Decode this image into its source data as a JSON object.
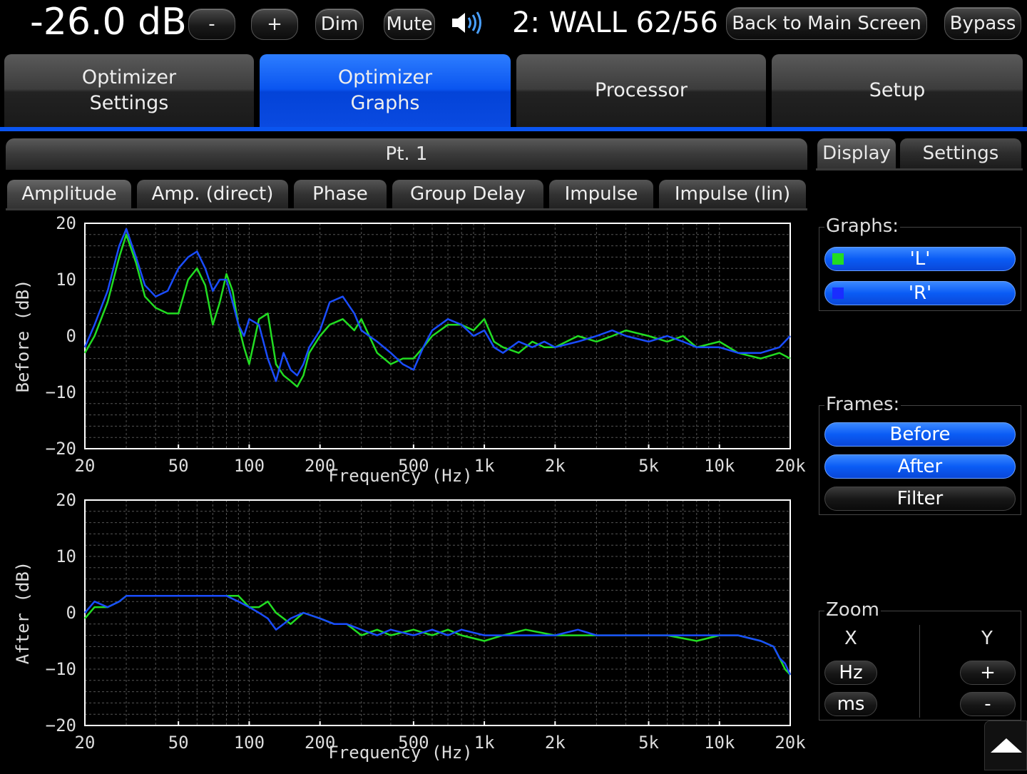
{
  "topbar": {
    "volume": "-26.0 dB",
    "minus_label": "-",
    "plus_label": "+",
    "dim_label": "Dim",
    "mute_label": "Mute",
    "preset": "2: WALL 62/56",
    "back_label": "Back to Main Screen",
    "bypass_label": "Bypass"
  },
  "tabs": [
    {
      "line1": "Optimizer",
      "line2": "Settings"
    },
    {
      "line1": "Optimizer",
      "line2": "Graphs"
    },
    {
      "line1": "Processor",
      "line2": ""
    },
    {
      "line1": "Setup",
      "line2": ""
    }
  ],
  "point_title": "Pt. 1",
  "subtabs": [
    "Amplitude",
    "Amp. (direct)",
    "Phase",
    "Group Delay",
    "Impulse",
    "Impulse (lin)"
  ],
  "side": {
    "display_tab": "Display",
    "settings_tab": "Settings",
    "graphs_label": "Graphs:",
    "graph_L": "'L'",
    "graph_R": "'R'",
    "frames_label": "Frames:",
    "before": "Before",
    "after": "After",
    "filter": "Filter",
    "zoom_label": "Zoom",
    "x_label": "X",
    "y_label": "Y",
    "hz": "Hz",
    "ms": "ms",
    "yplus": "+",
    "yminus": "-"
  },
  "colors": {
    "L": "#22dd22",
    "R": "#1a4dff",
    "accent": "#0a55f0"
  },
  "chart_data": [
    {
      "type": "line",
      "ylabel": "Before (dB)",
      "xlabel": "Frequency (Hz)",
      "x_scale": "log",
      "xlim": [
        20,
        20000
      ],
      "ylim": [
        -20,
        20
      ],
      "x_ticks": [
        20,
        50,
        100,
        200,
        500,
        1000,
        2000,
        5000,
        10000,
        20000
      ],
      "x_tick_labels": [
        "20",
        "50",
        "100",
        "200",
        "500",
        "1k",
        "2k",
        "5k",
        "10k",
        "20k"
      ],
      "y_ticks": [
        -20,
        -10,
        0,
        10,
        20
      ],
      "y_tick_labels": [
        "−20",
        "−10",
        "0",
        "10",
        "20"
      ],
      "grid": true,
      "series": [
        {
          "name": "'L'",
          "color": "#22dd22",
          "x": [
            20,
            22,
            25,
            28,
            30,
            33,
            36,
            40,
            45,
            50,
            55,
            60,
            65,
            70,
            75,
            80,
            85,
            90,
            95,
            100,
            110,
            120,
            130,
            140,
            150,
            160,
            170,
            180,
            200,
            220,
            250,
            280,
            300,
            350,
            400,
            450,
            500,
            550,
            600,
            700,
            800,
            900,
            1000,
            1100,
            1200,
            1400,
            1600,
            1800,
            2000,
            2500,
            3000,
            3500,
            4000,
            5000,
            6000,
            7000,
            8000,
            10000,
            12000,
            15000,
            18000,
            20000
          ],
          "y": [
            -3,
            0,
            6,
            14,
            18,
            13,
            7,
            5,
            4,
            4,
            10,
            12,
            9,
            2,
            6,
            11,
            8,
            2,
            -2,
            -5,
            3,
            4,
            -5,
            -7,
            -8,
            -9,
            -7,
            -3,
            0,
            2,
            3,
            1,
            3,
            -3,
            -5,
            -4,
            -4,
            -2,
            0,
            2,
            2,
            1,
            3,
            -1,
            -2,
            -3,
            -1,
            -2,
            -2,
            0,
            -1,
            0,
            1,
            0,
            -1,
            0,
            -2,
            -1,
            -3,
            -4,
            -3,
            -4
          ]
        },
        {
          "name": "'R'",
          "color": "#1a4dff",
          "x": [
            20,
            22,
            25,
            28,
            30,
            33,
            36,
            40,
            45,
            50,
            55,
            60,
            65,
            70,
            75,
            80,
            85,
            90,
            95,
            100,
            110,
            120,
            130,
            140,
            150,
            160,
            170,
            180,
            200,
            220,
            250,
            280,
            300,
            350,
            400,
            450,
            500,
            550,
            600,
            700,
            800,
            900,
            1000,
            1100,
            1200,
            1400,
            1600,
            1800,
            2000,
            2500,
            3000,
            3500,
            4000,
            5000,
            6000,
            7000,
            8000,
            10000,
            12000,
            15000,
            18000,
            20000
          ],
          "y": [
            -2,
            2,
            8,
            16,
            19,
            14,
            9,
            7,
            8,
            12,
            14,
            15,
            12,
            8,
            10,
            10,
            6,
            2,
            0,
            3,
            2,
            -4,
            -8,
            -3,
            -6,
            -7,
            -5,
            -2,
            1,
            6,
            7,
            4,
            1,
            -1,
            -3,
            -5,
            -6,
            -2,
            1,
            3,
            2,
            0,
            1,
            -2,
            -3,
            -1,
            -2,
            -1,
            -2,
            -1,
            0,
            1,
            0,
            -1,
            0,
            -1,
            -2,
            -2,
            -3,
            -3,
            -2,
            0
          ]
        }
      ]
    },
    {
      "type": "line",
      "ylabel": "After (dB)",
      "xlabel": "Frequency (Hz)",
      "x_scale": "log",
      "xlim": [
        20,
        20000
      ],
      "ylim": [
        -20,
        20
      ],
      "x_ticks": [
        20,
        50,
        100,
        200,
        500,
        1000,
        2000,
        5000,
        10000,
        20000
      ],
      "x_tick_labels": [
        "20",
        "50",
        "100",
        "200",
        "500",
        "1k",
        "2k",
        "5k",
        "10k",
        "20k"
      ],
      "y_ticks": [
        -20,
        -10,
        0,
        10,
        20
      ],
      "y_tick_labels": [
        "−20",
        "−10",
        "0",
        "10",
        "20"
      ],
      "grid": true,
      "series": [
        {
          "name": "'L'",
          "color": "#22dd22",
          "x": [
            20,
            22,
            25,
            28,
            30,
            35,
            40,
            45,
            50,
            60,
            70,
            80,
            90,
            100,
            110,
            120,
            130,
            140,
            150,
            170,
            200,
            230,
            260,
            300,
            350,
            400,
            500,
            600,
            700,
            800,
            1000,
            1200,
            1500,
            2000,
            2500,
            3000,
            4000,
            5000,
            6000,
            8000,
            10000,
            12000,
            15000,
            17000,
            18000,
            19000,
            20000
          ],
          "y": [
            -1,
            1,
            1,
            2,
            3,
            3,
            3,
            3,
            3,
            3,
            3,
            3,
            3,
            1,
            1,
            2,
            0,
            -1,
            -2,
            0,
            -1,
            -2,
            -2,
            -4,
            -3,
            -4,
            -3,
            -4,
            -3,
            -4,
            -5,
            -4,
            -3,
            -4,
            -4,
            -4,
            -4,
            -4,
            -4,
            -5,
            -4,
            -4,
            -5,
            -6,
            -8,
            -10,
            -11
          ]
        },
        {
          "name": "'R'",
          "color": "#1a4dff",
          "x": [
            20,
            22,
            25,
            28,
            30,
            35,
            40,
            45,
            50,
            60,
            70,
            80,
            90,
            100,
            110,
            120,
            130,
            140,
            150,
            170,
            200,
            230,
            260,
            300,
            350,
            400,
            500,
            600,
            700,
            800,
            1000,
            1200,
            1500,
            2000,
            2500,
            3000,
            4000,
            5000,
            6000,
            8000,
            10000,
            12000,
            15000,
            17000,
            18000,
            19000,
            20000
          ],
          "y": [
            0,
            2,
            1,
            2,
            3,
            3,
            3,
            3,
            3,
            3,
            3,
            3,
            2,
            1,
            0,
            -1,
            -3,
            -2,
            -1,
            0,
            -1,
            -2,
            -2,
            -3,
            -4,
            -3,
            -4,
            -3,
            -4,
            -3,
            -4,
            -4,
            -4,
            -4,
            -3,
            -4,
            -4,
            -4,
            -4,
            -4,
            -4,
            -4,
            -5,
            -6,
            -8,
            -9,
            -11
          ]
        }
      ]
    }
  ]
}
